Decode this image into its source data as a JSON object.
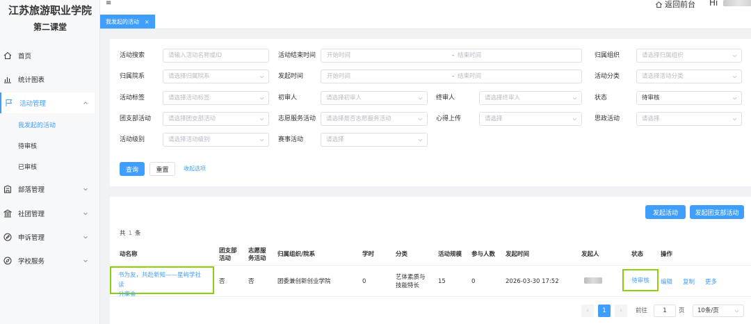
{
  "brand": {
    "title": "江苏旅游职业学院",
    "subtitle": "第二课堂"
  },
  "sidebar": {
    "items": [
      {
        "label": "首页",
        "icon": "home-icon"
      },
      {
        "label": "统计图表",
        "icon": "bar-chart-icon"
      },
      {
        "label": "活动管理",
        "icon": "flag-icon",
        "expanded": true
      },
      {
        "label": "部落管理",
        "icon": "building-icon"
      },
      {
        "label": "社团管理",
        "icon": "bank-icon"
      },
      {
        "label": "申诉管理",
        "icon": "edit-icon"
      },
      {
        "label": "学校服务",
        "icon": "compass-icon"
      }
    ],
    "sub_items": [
      {
        "label": "我发起的活动",
        "active": true
      },
      {
        "label": "待审核"
      },
      {
        "label": "已审核"
      }
    ]
  },
  "header": {
    "menu_icon": "≡",
    "back_label": "返回前台",
    "greeting": "Hi"
  },
  "tabs": [
    {
      "label": "我发起的活动",
      "close": "×"
    }
  ],
  "filters": {
    "activity_search": {
      "label": "活动搜索",
      "placeholder": "请输入活动名称或ID"
    },
    "end_time": {
      "label": "活动结束时间",
      "start": "开始时间",
      "sep": "-",
      "end": "结束时间"
    },
    "org": {
      "label": "归属组织",
      "placeholder": "请选择归属组织"
    },
    "college": {
      "label": "归属院系",
      "placeholder": "请选择归属院系"
    },
    "start_time": {
      "label": "发起时间",
      "start": "开始时间",
      "sep": "-",
      "end": "结束时间"
    },
    "category": {
      "label": "活动分类",
      "placeholder": "请选择活动分类"
    },
    "tag": {
      "label": "活动标签",
      "placeholder": "请选择活动标签"
    },
    "first_reviewer": {
      "label": "初审人",
      "placeholder": "请选择初审人"
    },
    "final_reviewer": {
      "label": "终审人",
      "placeholder": "请选择终审人"
    },
    "status": {
      "label": "状态",
      "value": "待审核"
    },
    "league": {
      "label": "团支部活动",
      "placeholder": "请选择团支部活动"
    },
    "volunteer": {
      "label": "志愿服务活动",
      "placeholder": "请选择是否志愿服务活动"
    },
    "reflection": {
      "label": "心得上传",
      "placeholder": "请选择"
    },
    "ideology": {
      "label": "思政活动",
      "placeholder": "请选择"
    },
    "level": {
      "label": "活动级别",
      "placeholder": "请选择活动级别"
    },
    "contest": {
      "label": "赛事活动",
      "placeholder": "请选择"
    },
    "buttons": {
      "query": "查询",
      "reset": "重置",
      "collapse": "收起选项"
    }
  },
  "table": {
    "actions": {
      "launch": "发起活动",
      "launch_league": "发起团支部活动"
    },
    "total_prefix": "共",
    "total_count": "1",
    "total_suffix": "条",
    "columns": {
      "name": "动名称",
      "league1": "团支部",
      "league2": "活动",
      "vol1": "志愿服",
      "vol2": "务活动",
      "org": "归属组织/院系",
      "hours": "学时",
      "category": "分类",
      "scale": "活动规模",
      "participants": "参与人数",
      "start": "发起时间",
      "initiator": "发起人",
      "status": "状态",
      "ops": "操作"
    },
    "row": {
      "name_line1": "书为友，共赴新知——星屿学社读",
      "name_line2": "分享会",
      "league": "否",
      "volunteer": "否",
      "org": "团委兼创新创业学院",
      "hours": "0",
      "category_line1": "艺体素质与",
      "category_line2": "技能特长",
      "scale": "15",
      "participants": "0",
      "start": "2026-03-30 17:52",
      "status": "待审核",
      "op_edit": "编辑",
      "op_copy": "复制",
      "op_more": "更多"
    }
  },
  "pagination": {
    "prev": "‹",
    "current": "1",
    "next": "›",
    "goto_label": "前往",
    "goto_value": "1",
    "page_label": "页",
    "page_size": "10条/页"
  }
}
